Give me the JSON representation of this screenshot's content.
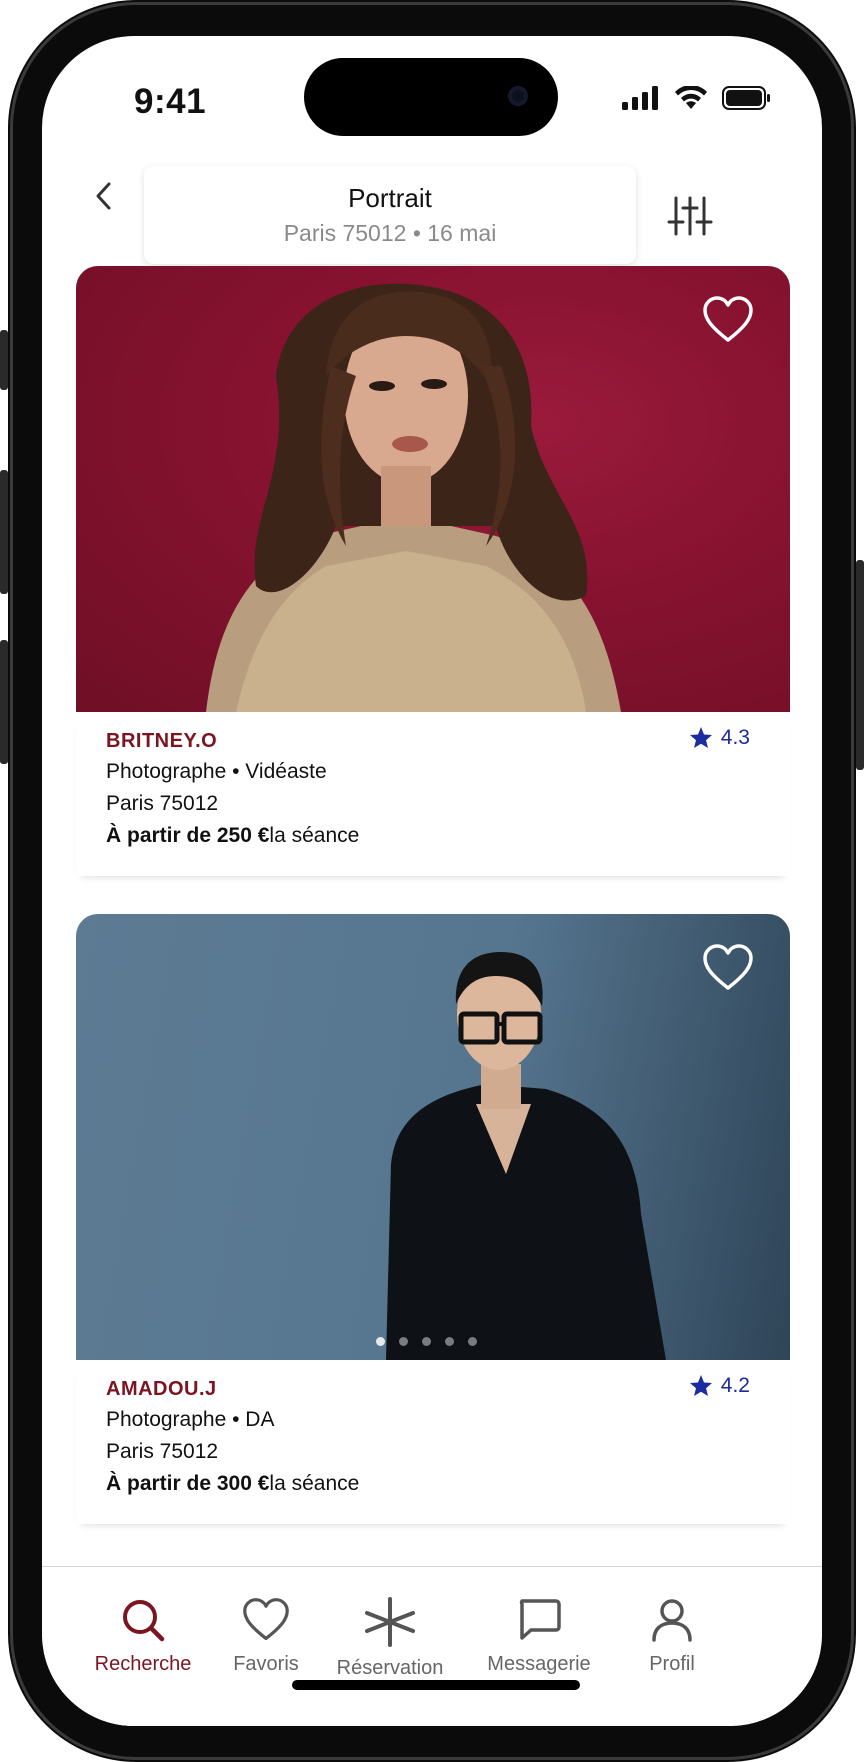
{
  "status_bar": {
    "time": "9:41"
  },
  "header": {
    "title": "Portrait",
    "subtitle": "Paris 75012 •  16 mai"
  },
  "listings": [
    {
      "name": "BRITNEY.O",
      "rating": "4.3",
      "roles": "Photographe • Vidéaste",
      "location": "Paris 75012",
      "price_prefix": "À partir de 250 €",
      "price_suffix": "la séance"
    },
    {
      "name": "AMADOU.J",
      "rating": "4.2",
      "roles": "Photographe • DA",
      "location": "Paris 75012",
      "price_prefix": "À partir de 300 €",
      "price_suffix": "la séance"
    }
  ],
  "tabbar": {
    "items": [
      {
        "label": "Recherche",
        "icon": "search-icon",
        "active": true
      },
      {
        "label": "Favoris",
        "icon": "heart-icon",
        "active": false
      },
      {
        "label": "Réservation",
        "icon": "asterisk-icon",
        "active": false
      },
      {
        "label": "Messagerie",
        "icon": "chat-icon",
        "active": false
      },
      {
        "label": "Profil",
        "icon": "person-icon",
        "active": false
      }
    ]
  },
  "colors": {
    "accent": "#7a1521",
    "rating": "#1b2c9e",
    "photo1_bg": "#8a1331",
    "photo2_bg": "#5f7f98"
  }
}
